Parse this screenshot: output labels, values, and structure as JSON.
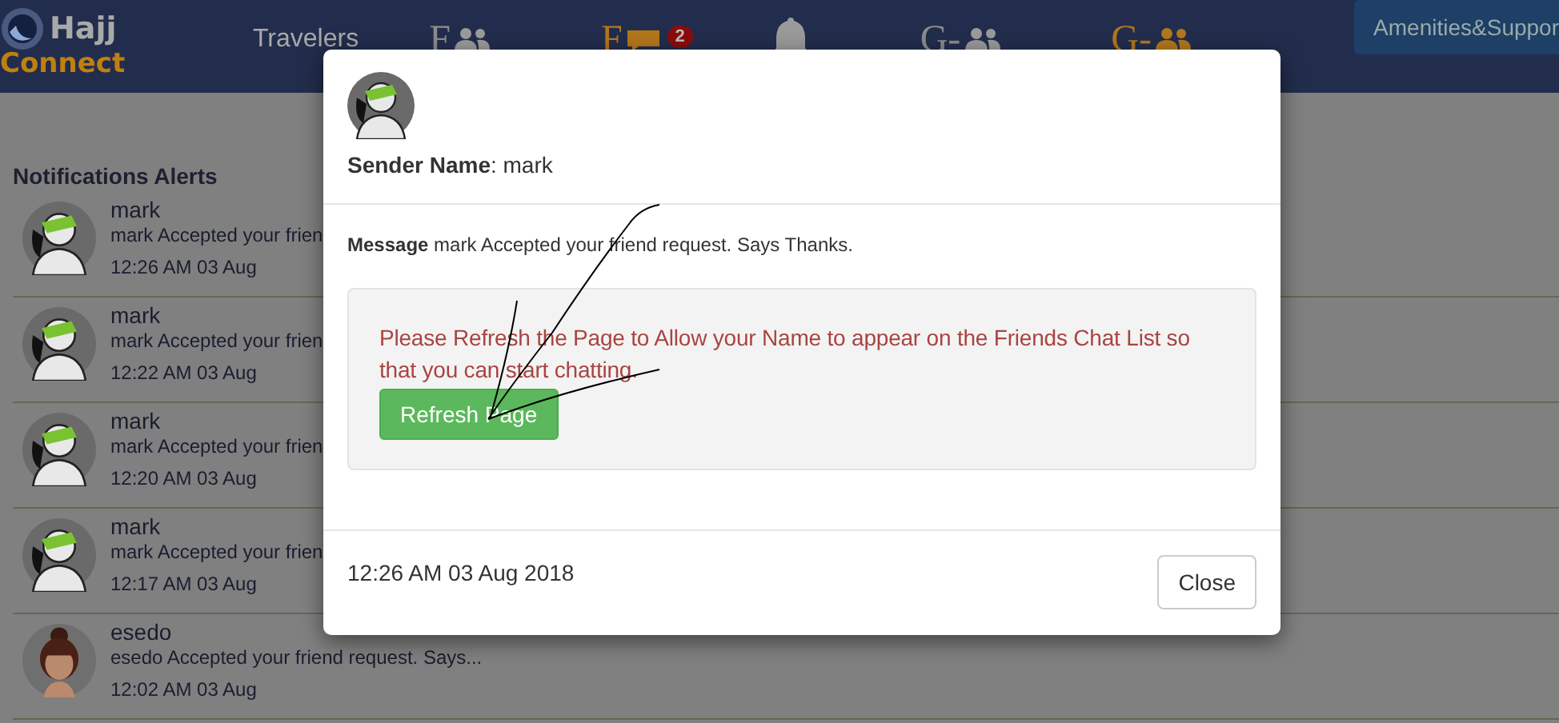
{
  "brand": {
    "name": "Hajj",
    "tagline": "Connect"
  },
  "nav": [
    {
      "kind": "text",
      "label": "Travelers",
      "highlighted": false
    },
    {
      "kind": "friends",
      "label": "F",
      "highlighted": false
    },
    {
      "kind": "chat",
      "label": "F",
      "badge": "2",
      "highlighted": true
    },
    {
      "kind": "bell",
      "highlighted": false
    },
    {
      "kind": "group",
      "label": "G-",
      "highlighted": false
    },
    {
      "kind": "group",
      "label": "G-",
      "highlighted": true
    }
  ],
  "nav_button": "Amenities&Suppor",
  "notifications": {
    "title": "Notifications Alerts",
    "items": [
      {
        "kind": "sketch",
        "name": "mark",
        "text": "mark Accepted your frien",
        "time": "12:26 AM 03 Aug"
      },
      {
        "kind": "sketch",
        "name": "mark",
        "text": "mark Accepted your frien",
        "time": "12:22 AM 03 Aug"
      },
      {
        "kind": "sketch",
        "name": "mark",
        "text": "mark Accepted your frien",
        "time": "12:20 AM 03 Aug"
      },
      {
        "kind": "sketch",
        "name": "mark",
        "text": "mark Accepted your frien",
        "time": "12:17 AM 03 Aug"
      },
      {
        "kind": "cartoon",
        "name": "esedo",
        "text": "esedo Accepted your friend request. Says...",
        "time": "12:02 AM 03 Aug"
      }
    ]
  },
  "modal": {
    "sender": "**Sender Name**: mark",
    "message": "**Message** mark Accepted your friend request. Says Thanks.",
    "notice": "Please Refresh the Page to Allow your Name to appear on the Friends Chat List so that you can start chatting.",
    "refresh_button": "Refresh Page",
    "time": "12:26 AM 03 Aug 2018",
    "close_button": "Close"
  }
}
